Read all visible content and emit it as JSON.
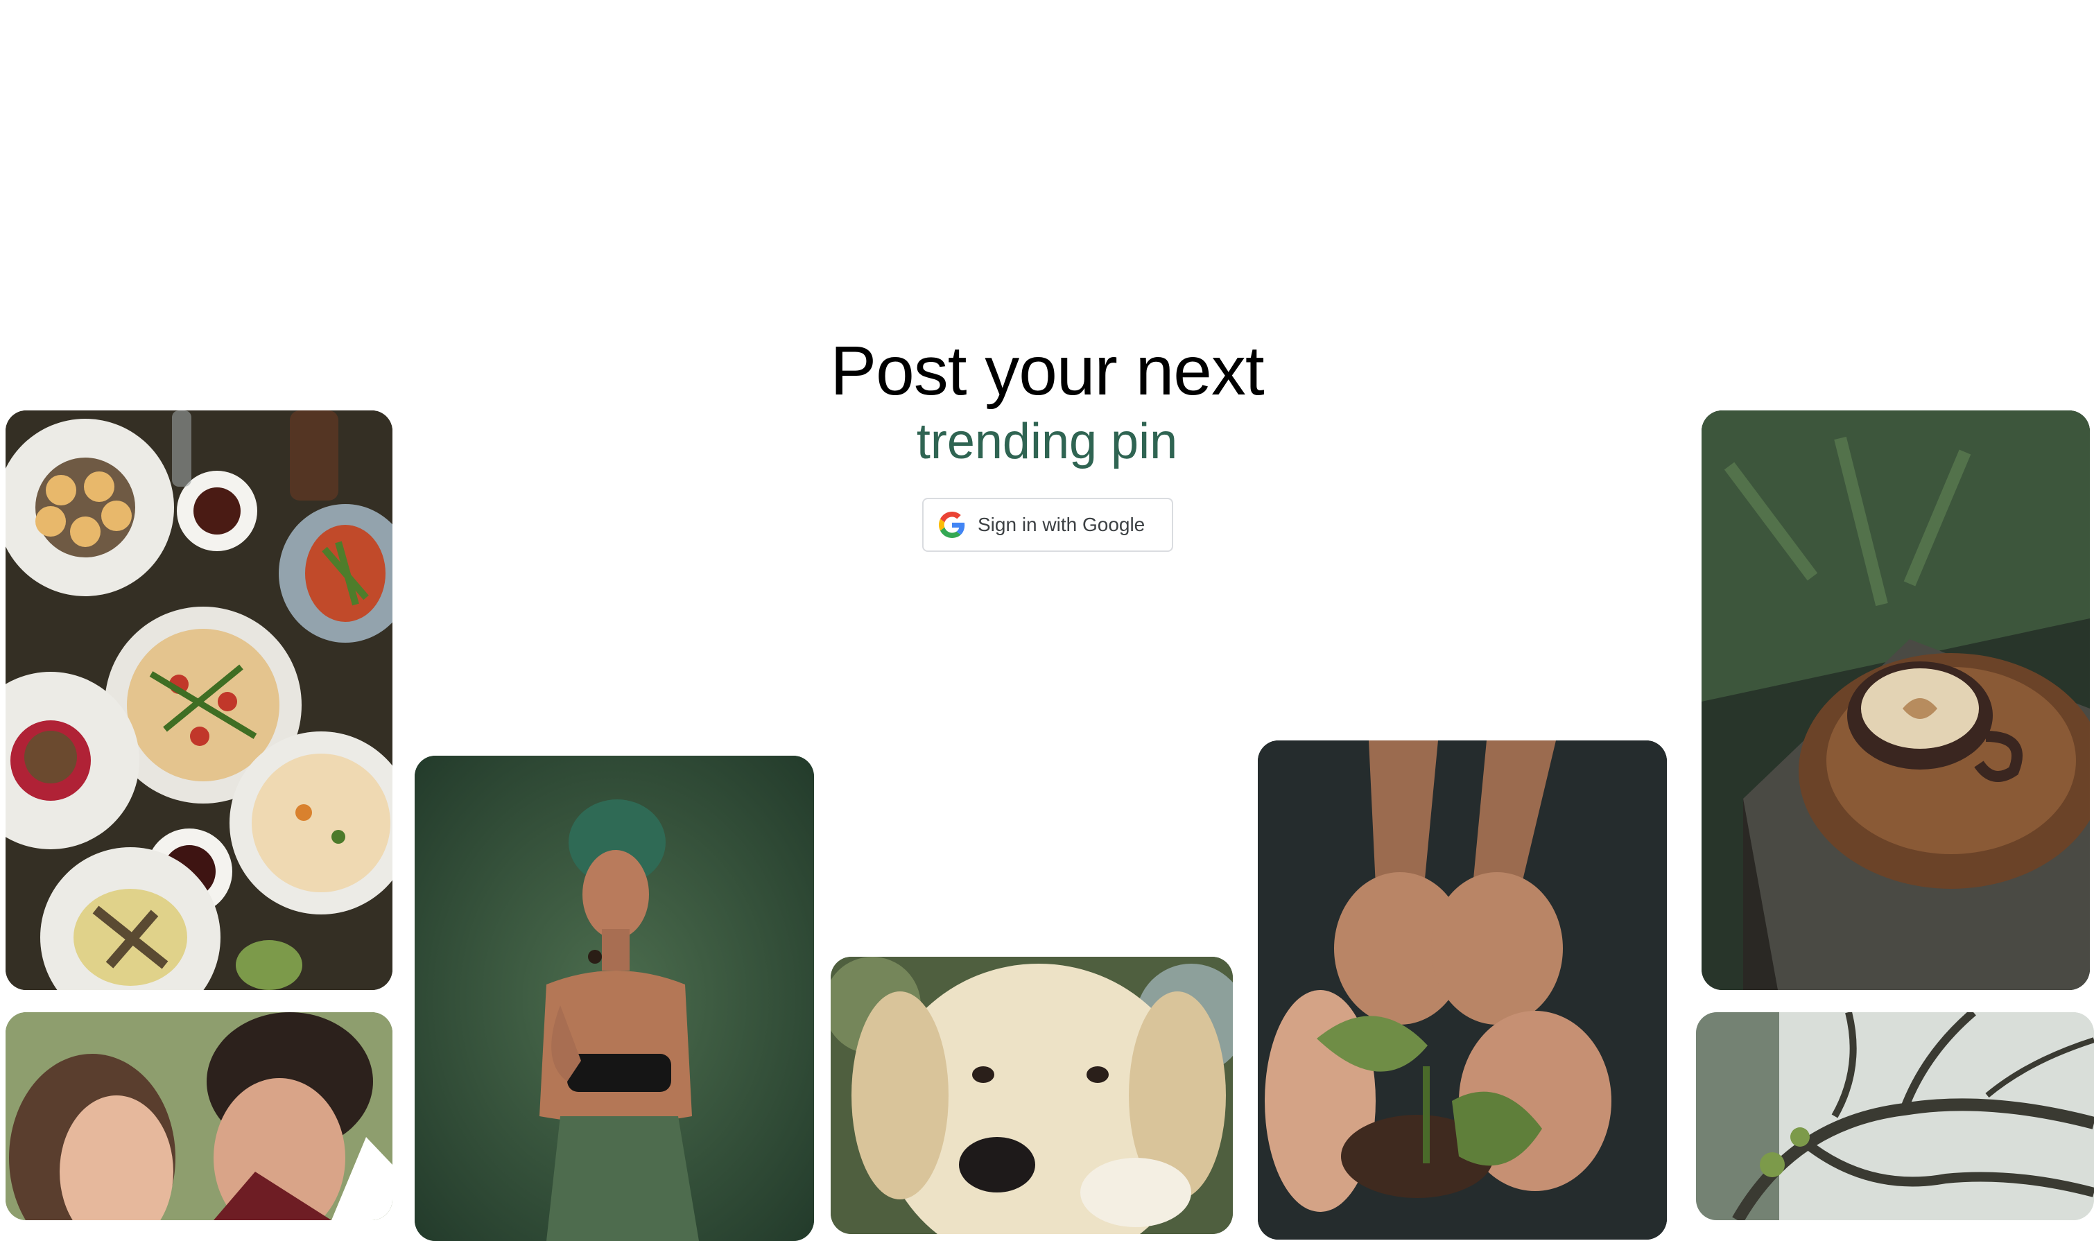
{
  "hero": {
    "title": "Post your next",
    "subtitle": "trending pin"
  },
  "signin": {
    "label": "Sign in with Google",
    "icon": "google-g-icon"
  },
  "colors": {
    "subtitle": "#2f6452",
    "button_border": "#dadce0",
    "button_text": "#3c4043"
  },
  "tiles": [
    {
      "name": "food-platter-image",
      "subject": "table of plates with pizza and tea"
    },
    {
      "name": "couple-image",
      "subject": "smiling couple outdoors"
    },
    {
      "name": "woman-headwrap-image",
      "subject": "woman in green headwrap"
    },
    {
      "name": "dog-image",
      "subject": "yellow labrador puppy"
    },
    {
      "name": "hands-plant-image",
      "subject": "hands around a green seedling"
    },
    {
      "name": "coffee-cup-image",
      "subject": "latte on wooden tray"
    },
    {
      "name": "tree-image",
      "subject": "mossy tree branches"
    }
  ]
}
